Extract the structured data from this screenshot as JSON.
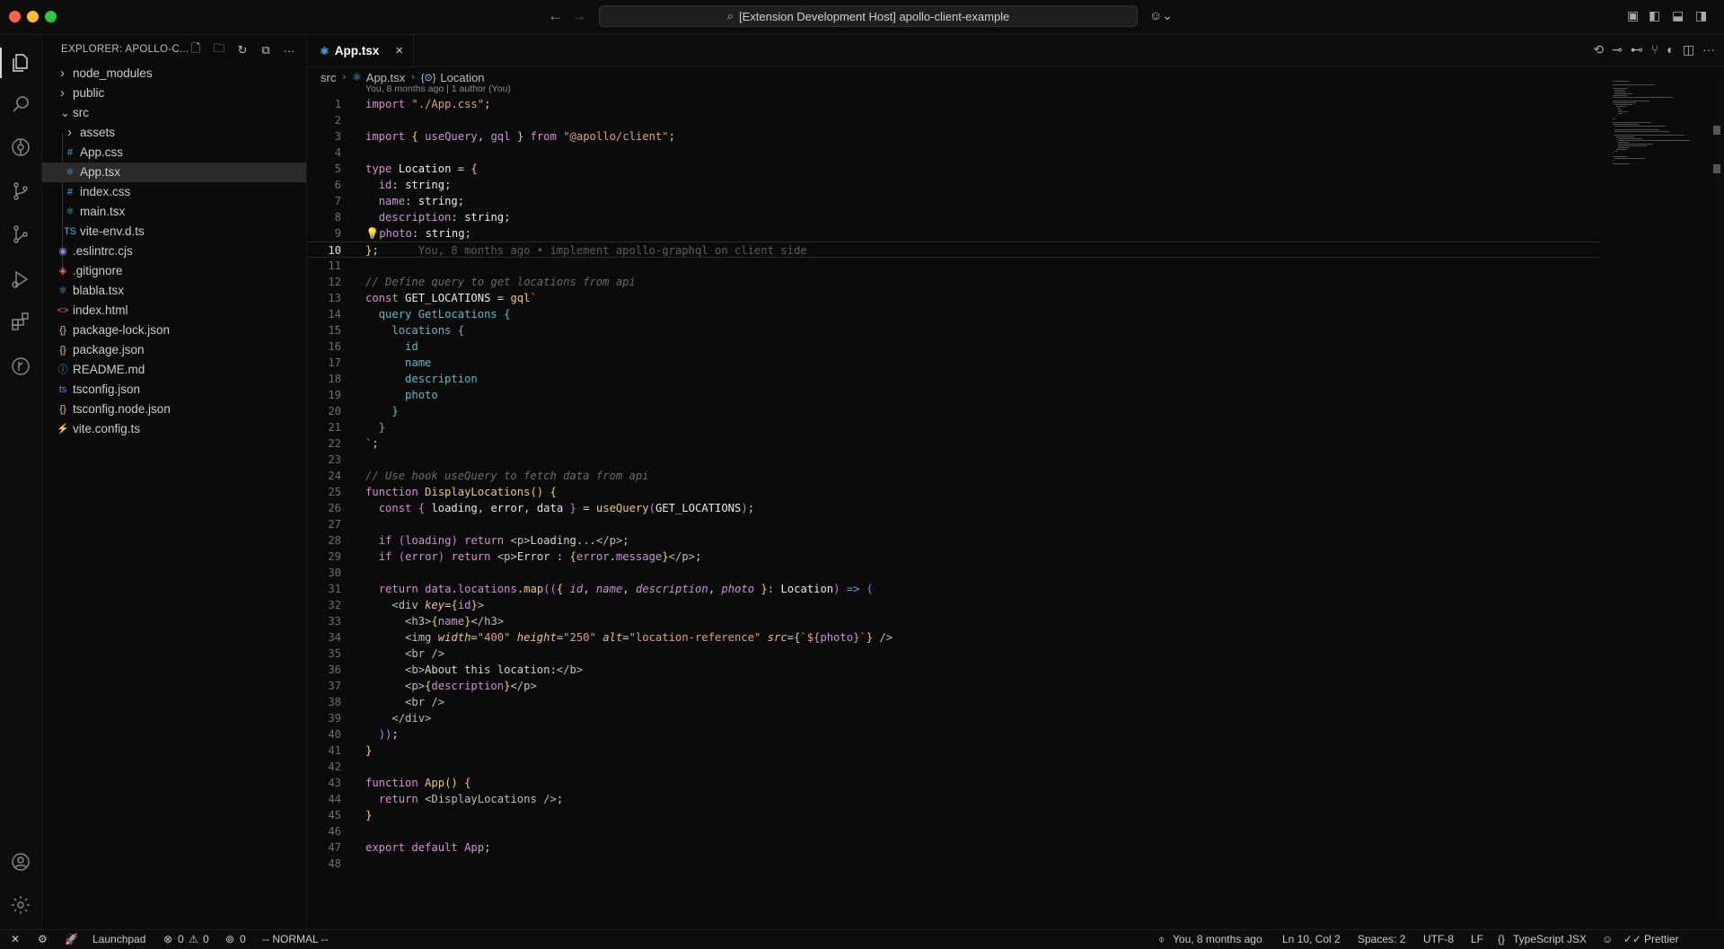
{
  "titlebar": {
    "command_center": "[Extension Development Host] apollo-client-example"
  },
  "explorer": {
    "title": "EXPLORER: APOLLO-C...",
    "items": [
      {
        "name": "node_modules",
        "kind": "folder",
        "expanded": false,
        "depth": 0
      },
      {
        "name": "public",
        "kind": "folder",
        "expanded": false,
        "depth": 0
      },
      {
        "name": "src",
        "kind": "folder",
        "expanded": true,
        "depth": 0
      },
      {
        "name": "assets",
        "kind": "folder",
        "expanded": false,
        "depth": 1
      },
      {
        "name": "App.css",
        "kind": "css",
        "depth": 1,
        "icon": "#"
      },
      {
        "name": "App.tsx",
        "kind": "react",
        "depth": 1,
        "icon": "⚛",
        "selected": true
      },
      {
        "name": "index.css",
        "kind": "css",
        "depth": 1,
        "icon": "#"
      },
      {
        "name": "main.tsx",
        "kind": "react",
        "depth": 1,
        "icon": "⚛"
      },
      {
        "name": "vite-env.d.ts",
        "kind": "ts",
        "depth": 1,
        "icon": "TS"
      },
      {
        "name": ".eslintrc.cjs",
        "kind": "eslint",
        "depth": 0,
        "icon": "◉"
      },
      {
        "name": ".gitignore",
        "kind": "git",
        "depth": 0,
        "icon": "◈"
      },
      {
        "name": "blabla.tsx",
        "kind": "react",
        "depth": 0,
        "icon": "⚛"
      },
      {
        "name": "index.html",
        "kind": "html",
        "depth": 0,
        "icon": "<>"
      },
      {
        "name": "package-lock.json",
        "kind": "json",
        "depth": 0,
        "icon": "{}"
      },
      {
        "name": "package.json",
        "kind": "json",
        "depth": 0,
        "icon": "{}"
      },
      {
        "name": "README.md",
        "kind": "info",
        "depth": 0,
        "icon": "ⓘ"
      },
      {
        "name": "tsconfig.json",
        "kind": "tsconfig",
        "depth": 0,
        "icon": "ts"
      },
      {
        "name": "tsconfig.node.json",
        "kind": "json",
        "depth": 0,
        "icon": "{}"
      },
      {
        "name": "vite.config.ts",
        "kind": "vite",
        "depth": 0,
        "icon": "⚡"
      }
    ]
  },
  "editor": {
    "tab": {
      "label": "App.tsx"
    },
    "breadcrumb": {
      "folder": "src",
      "file": "App.tsx",
      "symbol": "Location"
    },
    "codelens": "You, 8 months ago | 1 author (You)",
    "current_line": 10,
    "lines": [
      "<span class=\"kw\">import</span> <span class=\"str\">\"./App.css\"</span>;",
      "",
      "<span class=\"kw\">import</span> <span class=\"br\">{</span> <span class=\"prop\">useQuery</span>, <span class=\"prop\">gql</span> <span class=\"br\">}</span> <span class=\"kw\">from</span> <span class=\"str\">\"@apollo/client\"</span>;",
      "",
      "<span class=\"kw\">type</span> <span class=\"ty\">Location</span> = <span class=\"br\">{</span>",
      "  <span class=\"prop\">id</span>: <span class=\"ty\">string</span>;",
      "  <span class=\"prop\">name</span>: <span class=\"ty\">string</span>;",
      "  <span class=\"prop\">description</span>: <span class=\"ty\">string</span>;",
      "<span class=\"bulb\">💡</span><span class=\"prop\">photo</span>: <span class=\"ty\">string</span>;",
      "<span class=\"br\">}</span>;      <span class=\"blame\">You, 8 months ago • implement apollo-graphql on client side</span>",
      "",
      "<span class=\"cm\">// Define query to get locations from api</span>",
      "<span class=\"kw\">const</span> <span class=\"ty\">GET_LOCATIONS</span> = <span class=\"fn\">gql</span><span class=\"str\">`</span>",
      "  <span class=\"gql\">query</span> <span class=\"gql\">GetLocations</span> <span class=\"gql\">{</span>",
      "    <span class=\"gql\">locations</span> <span class=\"gql\">{</span>",
      "      <span class=\"gql\">id</span>",
      "      <span class=\"gql\">name</span>",
      "      <span class=\"gql\">description</span>",
      "      <span class=\"gql\">photo</span>",
      "    <span class=\"gql\">}</span>",
      "  <span class=\"gql\">}</span>",
      "<span class=\"str\">`</span>;",
      "",
      "<span class=\"cm\">// Use hook useQuery to fetch data from api</span>",
      "<span class=\"kw\">function</span> <span class=\"fn\">DisplayLocations</span><span class=\"br\">()</span> <span class=\"br\">{</span>",
      "  <span class=\"kw\">const</span> <span class=\"br2\">{</span> <span class=\"ty\">loading</span>, <span class=\"ty\">error</span>, <span class=\"ty\">data</span> <span class=\"br2\">}</span> = <span class=\"fn\">useQuery</span><span class=\"br2\">(</span><span class=\"ty\">GET_LOCATIONS</span><span class=\"br2\">)</span>;",
      "",
      "  <span class=\"kw\">if</span> <span class=\"br2\">(</span><span class=\"prop\">loading</span><span class=\"br2\">)</span> <span class=\"kw\">return</span> <span class=\"tag\">&lt;p&gt;</span>Loading...<span class=\"tag\">&lt;/p&gt;</span>;",
      "  <span class=\"kw\">if</span> <span class=\"br2\">(</span><span class=\"prop\">error</span><span class=\"br2\">)</span> <span class=\"kw\">return</span> <span class=\"tag\">&lt;p&gt;</span>Error : <span class=\"br\">{</span><span class=\"prop\">error</span>.<span class=\"prop\">message</span><span class=\"br\">}</span><span class=\"tag\">&lt;/p&gt;</span>;",
      "",
      "  <span class=\"kw\">return</span> <span class=\"prop\">data</span>.<span class=\"prop\">locations</span>.<span class=\"fn\">map</span><span class=\"br2\">((</span><span class=\"br\">{</span> <span class=\"ital\">id</span>, <span class=\"ital\">name</span>, <span class=\"ital\">description</span>, <span class=\"ital\">photo</span> <span class=\"br\">}</span>: <span class=\"ty\">Location</span><span class=\"br2\">)</span> <span class=\"kw2\">=&gt;</span> <span class=\"kw2\">(</span>",
      "    <span class=\"tag\">&lt;div</span> <span class=\"attr\">key</span>=<span class=\"br\">{</span><span class=\"prop\">id</span><span class=\"br\">}</span><span class=\"tag\">&gt;</span>",
      "      <span class=\"tag\">&lt;h3&gt;</span><span class=\"br\">{</span><span class=\"prop\">name</span><span class=\"br\">}</span><span class=\"tag\">&lt;/h3&gt;</span>",
      "      <span class=\"tag\">&lt;img</span> <span class=\"attr\">width</span>=<span class=\"str\">\"400\"</span> <span class=\"attr\">height</span>=<span class=\"str\">\"250\"</span> <span class=\"attr\">alt</span>=<span class=\"str\">\"location-reference\"</span> <span class=\"attr\">src</span>=<span class=\"br\">{</span><span class=\"str\">`${</span><span class=\"prop\">photo</span><span class=\"str\">}`</span><span class=\"br\">}</span> <span class=\"tag\">/&gt;</span>",
      "      <span class=\"tag\">&lt;br /&gt;</span>",
      "      <span class=\"tag\">&lt;b&gt;</span>About this location:<span class=\"tag\">&lt;/b&gt;</span>",
      "      <span class=\"tag\">&lt;p&gt;</span><span class=\"br\">{</span><span class=\"prop\">description</span><span class=\"br\">}</span><span class=\"tag\">&lt;/p&gt;</span>",
      "      <span class=\"tag\">&lt;br /&gt;</span>",
      "    <span class=\"tag\">&lt;/div&gt;</span>",
      "  <span class=\"kw2\">)</span><span class=\"br2\">)</span>;",
      "<span class=\"br\">}</span>",
      "",
      "<span class=\"kw\">function</span> <span class=\"fn\">App</span><span class=\"br\">()</span> <span class=\"br\">{</span>",
      "  <span class=\"kw\">return</span> <span class=\"tag\">&lt;DisplayLocations /&gt;</span>;",
      "<span class=\"br\">}</span>",
      "",
      "<span class=\"kw\">export</span> <span class=\"kw\">default</span> <span class=\"prop\">App</span>;",
      ""
    ]
  },
  "statusbar": {
    "launchpad": "Launchpad",
    "errors": "0",
    "warnings": "0",
    "ports": "0",
    "vim_mode": "-- NORMAL --",
    "blame": "You, 8 months ago",
    "position": "Ln 10, Col 2",
    "spaces": "Spaces: 2",
    "encoding": "UTF-8",
    "eol": "LF",
    "language": "TypeScript JSX",
    "formatter": "Prettier"
  }
}
